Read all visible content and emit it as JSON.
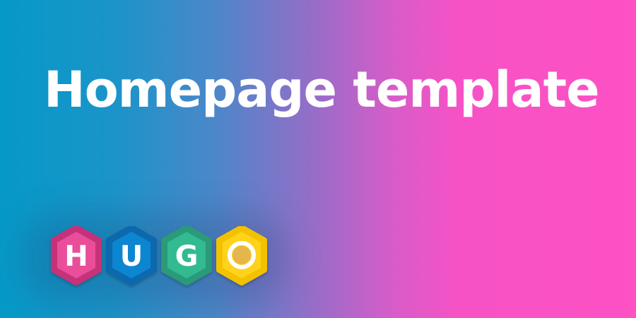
{
  "title": "Homepage template",
  "logo": {
    "letters": [
      "H",
      "U",
      "G",
      "O"
    ],
    "colors": {
      "h": "#ea4e9a",
      "u": "#0a86d1",
      "g": "#33ba91",
      "o": "#ffd21c",
      "o_inner": "#e7b64c"
    }
  },
  "colors": {
    "gradient_start": "#0599c8",
    "gradient_end": "#fd51c4",
    "text": "#ffffff"
  }
}
